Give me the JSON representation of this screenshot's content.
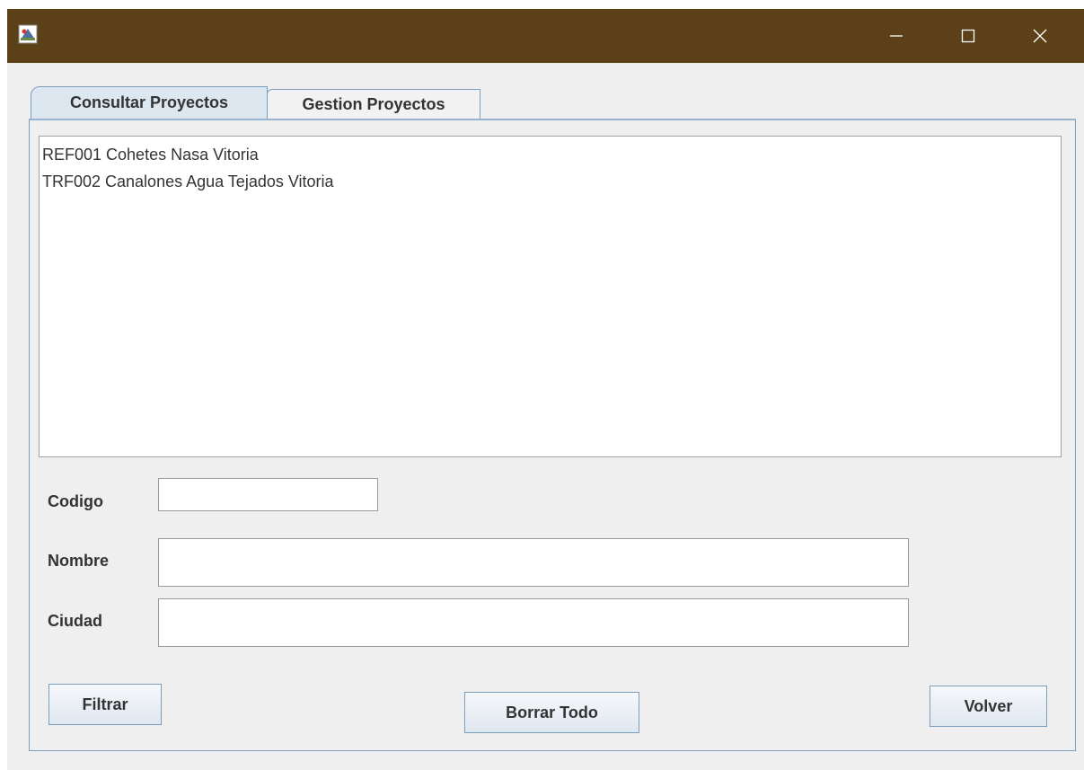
{
  "window": {
    "title": "",
    "titlebar_color": "#5c4118",
    "controls": {
      "minimize_icon": "minimize-icon",
      "maximize_icon": "maximize-icon",
      "close_icon": "close-icon"
    }
  },
  "tabs": [
    {
      "label": "Consultar Proyectos",
      "selected": true
    },
    {
      "label": "Gestion Proyectos",
      "selected": false
    }
  ],
  "project_list": {
    "items": [
      "REF001 Cohetes Nasa Vitoria",
      "TRF002 Canalones Agua Tejados Vitoria"
    ]
  },
  "form": {
    "codigo": {
      "label": "Codigo",
      "value": ""
    },
    "nombre": {
      "label": "Nombre",
      "value": ""
    },
    "ciudad": {
      "label": "Ciudad",
      "value": ""
    }
  },
  "buttons": {
    "filtrar": "Filtrar",
    "borrar_todo": "Borrar Todo",
    "volver": "Volver"
  },
  "colors": {
    "accent_border": "#7b9ebd",
    "window_background": "#efefef"
  }
}
